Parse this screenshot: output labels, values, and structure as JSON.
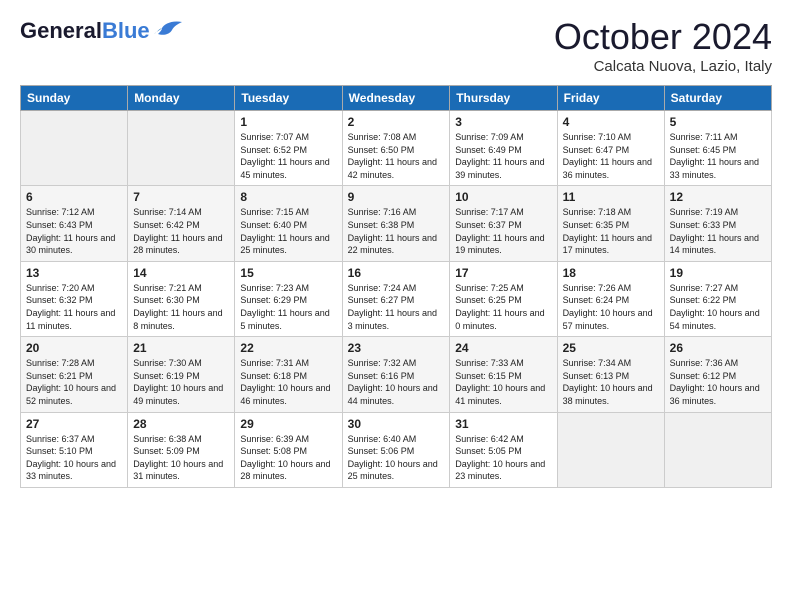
{
  "header": {
    "logo_general": "General",
    "logo_blue": "Blue",
    "title": "October 2024",
    "location": "Calcata Nuova, Lazio, Italy"
  },
  "days_of_week": [
    "Sunday",
    "Monday",
    "Tuesday",
    "Wednesday",
    "Thursday",
    "Friday",
    "Saturday"
  ],
  "weeks": [
    [
      {
        "day": "",
        "empty": true
      },
      {
        "day": "",
        "empty": true
      },
      {
        "day": "1",
        "sunrise": "7:07 AM",
        "sunset": "6:52 PM",
        "daylight": "11 hours and 45 minutes."
      },
      {
        "day": "2",
        "sunrise": "7:08 AM",
        "sunset": "6:50 PM",
        "daylight": "11 hours and 42 minutes."
      },
      {
        "day": "3",
        "sunrise": "7:09 AM",
        "sunset": "6:49 PM",
        "daylight": "11 hours and 39 minutes."
      },
      {
        "day": "4",
        "sunrise": "7:10 AM",
        "sunset": "6:47 PM",
        "daylight": "11 hours and 36 minutes."
      },
      {
        "day": "5",
        "sunrise": "7:11 AM",
        "sunset": "6:45 PM",
        "daylight": "11 hours and 33 minutes."
      }
    ],
    [
      {
        "day": "6",
        "sunrise": "7:12 AM",
        "sunset": "6:43 PM",
        "daylight": "11 hours and 30 minutes."
      },
      {
        "day": "7",
        "sunrise": "7:14 AM",
        "sunset": "6:42 PM",
        "daylight": "11 hours and 28 minutes."
      },
      {
        "day": "8",
        "sunrise": "7:15 AM",
        "sunset": "6:40 PM",
        "daylight": "11 hours and 25 minutes."
      },
      {
        "day": "9",
        "sunrise": "7:16 AM",
        "sunset": "6:38 PM",
        "daylight": "11 hours and 22 minutes."
      },
      {
        "day": "10",
        "sunrise": "7:17 AM",
        "sunset": "6:37 PM",
        "daylight": "11 hours and 19 minutes."
      },
      {
        "day": "11",
        "sunrise": "7:18 AM",
        "sunset": "6:35 PM",
        "daylight": "11 hours and 17 minutes."
      },
      {
        "day": "12",
        "sunrise": "7:19 AM",
        "sunset": "6:33 PM",
        "daylight": "11 hours and 14 minutes."
      }
    ],
    [
      {
        "day": "13",
        "sunrise": "7:20 AM",
        "sunset": "6:32 PM",
        "daylight": "11 hours and 11 minutes."
      },
      {
        "day": "14",
        "sunrise": "7:21 AM",
        "sunset": "6:30 PM",
        "daylight": "11 hours and 8 minutes."
      },
      {
        "day": "15",
        "sunrise": "7:23 AM",
        "sunset": "6:29 PM",
        "daylight": "11 hours and 5 minutes."
      },
      {
        "day": "16",
        "sunrise": "7:24 AM",
        "sunset": "6:27 PM",
        "daylight": "11 hours and 3 minutes."
      },
      {
        "day": "17",
        "sunrise": "7:25 AM",
        "sunset": "6:25 PM",
        "daylight": "11 hours and 0 minutes."
      },
      {
        "day": "18",
        "sunrise": "7:26 AM",
        "sunset": "6:24 PM",
        "daylight": "10 hours and 57 minutes."
      },
      {
        "day": "19",
        "sunrise": "7:27 AM",
        "sunset": "6:22 PM",
        "daylight": "10 hours and 54 minutes."
      }
    ],
    [
      {
        "day": "20",
        "sunrise": "7:28 AM",
        "sunset": "6:21 PM",
        "daylight": "10 hours and 52 minutes."
      },
      {
        "day": "21",
        "sunrise": "7:30 AM",
        "sunset": "6:19 PM",
        "daylight": "10 hours and 49 minutes."
      },
      {
        "day": "22",
        "sunrise": "7:31 AM",
        "sunset": "6:18 PM",
        "daylight": "10 hours and 46 minutes."
      },
      {
        "day": "23",
        "sunrise": "7:32 AM",
        "sunset": "6:16 PM",
        "daylight": "10 hours and 44 minutes."
      },
      {
        "day": "24",
        "sunrise": "7:33 AM",
        "sunset": "6:15 PM",
        "daylight": "10 hours and 41 minutes."
      },
      {
        "day": "25",
        "sunrise": "7:34 AM",
        "sunset": "6:13 PM",
        "daylight": "10 hours and 38 minutes."
      },
      {
        "day": "26",
        "sunrise": "7:36 AM",
        "sunset": "6:12 PM",
        "daylight": "10 hours and 36 minutes."
      }
    ],
    [
      {
        "day": "27",
        "sunrise": "6:37 AM",
        "sunset": "5:10 PM",
        "daylight": "10 hours and 33 minutes."
      },
      {
        "day": "28",
        "sunrise": "6:38 AM",
        "sunset": "5:09 PM",
        "daylight": "10 hours and 31 minutes."
      },
      {
        "day": "29",
        "sunrise": "6:39 AM",
        "sunset": "5:08 PM",
        "daylight": "10 hours and 28 minutes."
      },
      {
        "day": "30",
        "sunrise": "6:40 AM",
        "sunset": "5:06 PM",
        "daylight": "10 hours and 25 minutes."
      },
      {
        "day": "31",
        "sunrise": "6:42 AM",
        "sunset": "5:05 PM",
        "daylight": "10 hours and 23 minutes."
      },
      {
        "day": "",
        "empty": true
      },
      {
        "day": "",
        "empty": true
      }
    ]
  ]
}
